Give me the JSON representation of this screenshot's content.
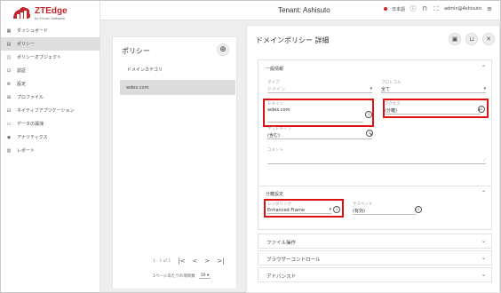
{
  "logo": {
    "brand": "ZTEdge",
    "sub": "by Ericom Software"
  },
  "sidebar": {
    "items": [
      {
        "label": "ダッシュボード",
        "icon": "grid-icon"
      },
      {
        "label": "ポリシー",
        "icon": "policy-icon",
        "active": true
      },
      {
        "label": "ポリシーオブジェクト",
        "icon": "object-icon"
      },
      {
        "label": "認証",
        "icon": "auth-icon"
      },
      {
        "label": "設定",
        "icon": "settings-icon"
      },
      {
        "label": "プロファイル",
        "icon": "profile-icon"
      },
      {
        "label": "ネイティブアプリケーション",
        "icon": "app-icon"
      },
      {
        "label": "データの漏洩",
        "icon": "data-icon"
      },
      {
        "label": "アナリティクス",
        "icon": "analytics-icon"
      },
      {
        "label": "レポート",
        "icon": "report-icon"
      }
    ]
  },
  "header": {
    "tenant": "Tenant: Ashisuto",
    "language": "日本語",
    "user": "admin@Ashisuto"
  },
  "policy_list": {
    "title": "ポリシー",
    "category": "ドメインカテゴリ",
    "selected_item": "wdex.com",
    "pagination": "1 - 1 of 1",
    "per_page_label": "1ページあたりの項目数",
    "per_page_value": "10"
  },
  "detail": {
    "title": "ドメインポリシー 詳細",
    "general_section": "一般情報",
    "type_label": "タイプ",
    "type_value": "ドメイン",
    "protocol_label": "プロトコル",
    "protocol_value": "全て",
    "domain_label": "ドメイン",
    "domain_value": "wdex.com",
    "access_label": "アクセス",
    "access_value": "(分離)",
    "subdomain_label": "サブドメイン",
    "subdomain_value": "(含む)",
    "comment_label": "コメント",
    "isolation_section": "分離設定",
    "rendering_label": "レンダリング",
    "rendering_value": "Enhanced Frame",
    "suspend_label": "サスペンド",
    "suspend_value": "(有効)",
    "file_ops": "ファイル操作",
    "browser_control": "ブラウザーコントロール",
    "advanced": "アドバンスド"
  }
}
